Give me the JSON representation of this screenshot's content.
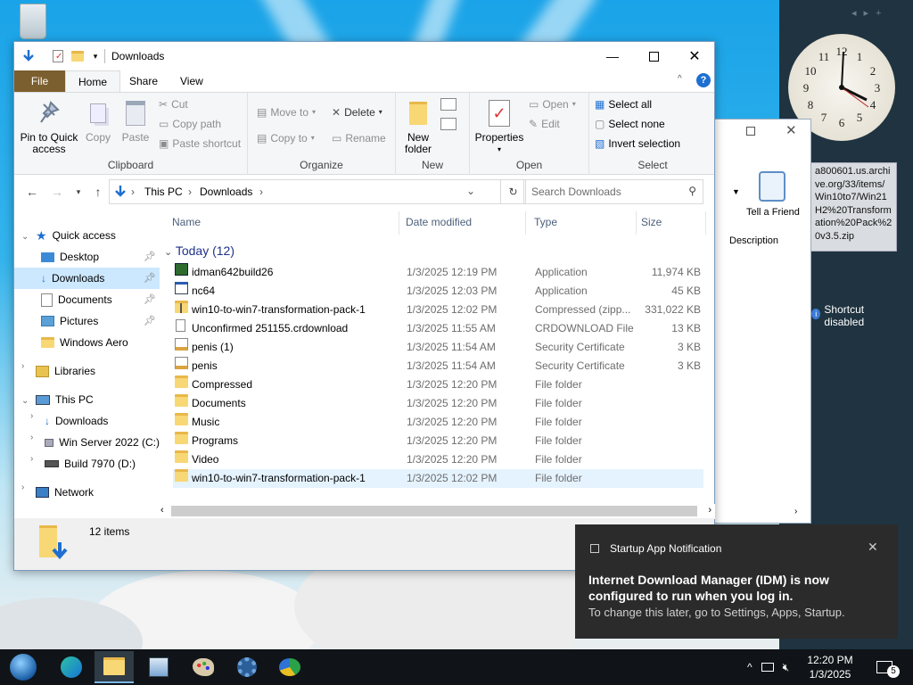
{
  "window": {
    "title": "Downloads"
  },
  "ribbon": {
    "tabs": [
      "File",
      "Home",
      "Share",
      "View"
    ],
    "clipboard": {
      "pin": "Pin to Quick access",
      "copy": "Copy",
      "paste": "Paste",
      "cut": "Cut",
      "copy_path": "Copy path",
      "paste_shortcut": "Paste shortcut",
      "label": "Clipboard"
    },
    "organize": {
      "move_to": "Move to",
      "copy_to": "Copy to",
      "delete": "Delete",
      "rename": "Rename",
      "label": "Organize"
    },
    "new": {
      "new_folder": "New folder",
      "label": "New"
    },
    "open": {
      "properties": "Properties",
      "open": "Open",
      "edit": "Edit",
      "label": "Open"
    },
    "select": {
      "select_all": "Select all",
      "select_none": "Select none",
      "invert": "Invert selection",
      "label": "Select"
    }
  },
  "address": {
    "this_pc": "This PC",
    "downloads": "Downloads",
    "search_placeholder": "Search Downloads"
  },
  "nav": {
    "quick_access": "Quick access",
    "items": [
      "Desktop",
      "Downloads",
      "Documents",
      "Pictures",
      "Windows Aero"
    ],
    "libraries": "Libraries",
    "this_pc": "This PC",
    "pc_items": [
      "Downloads",
      "Win Server 2022 (C:)",
      "Build 7970 (D:)"
    ],
    "network": "Network"
  },
  "columns": {
    "name": "Name",
    "date": "Date modified",
    "type": "Type",
    "size": "Size"
  },
  "group": "Today (12)",
  "files": [
    {
      "name": "idman642build26",
      "date": "1/3/2025 12:19 PM",
      "type": "Application",
      "size": "11,974 KB",
      "icon": "idm-icon"
    },
    {
      "name": "nc64",
      "date": "1/3/2025 12:03 PM",
      "type": "Application",
      "size": "45 KB",
      "icon": "app-icon"
    },
    {
      "name": "win10-to-win7-transformation-pack-1",
      "date": "1/3/2025 12:02 PM",
      "type": "Compressed (zipp...",
      "size": "331,022 KB",
      "icon": "zip-icon"
    },
    {
      "name": "Unconfirmed 251155.crdownload",
      "date": "1/3/2025 11:55 AM",
      "type": "CRDOWNLOAD File",
      "size": "13 KB",
      "icon": "file-icon"
    },
    {
      "name": "penis (1)",
      "date": "1/3/2025 11:54 AM",
      "type": "Security Certificate",
      "size": "3 KB",
      "icon": "cert-icon"
    },
    {
      "name": "penis",
      "date": "1/3/2025 11:54 AM",
      "type": "Security Certificate",
      "size": "3 KB",
      "icon": "cert-icon"
    },
    {
      "name": "Compressed",
      "date": "1/3/2025 12:20 PM",
      "type": "File folder",
      "size": "",
      "icon": "folder-icon"
    },
    {
      "name": "Documents",
      "date": "1/3/2025 12:20 PM",
      "type": "File folder",
      "size": "",
      "icon": "folder-icon"
    },
    {
      "name": "Music",
      "date": "1/3/2025 12:20 PM",
      "type": "File folder",
      "size": "",
      "icon": "folder-icon"
    },
    {
      "name": "Programs",
      "date": "1/3/2025 12:20 PM",
      "type": "File folder",
      "size": "",
      "icon": "folder-icon"
    },
    {
      "name": "Video",
      "date": "1/3/2025 12:20 PM",
      "type": "File folder",
      "size": "",
      "icon": "folder-icon"
    },
    {
      "name": "win10-to-win7-transformation-pack-1",
      "date": "1/3/2025 12:02 PM",
      "type": "File folder",
      "size": "",
      "icon": "folder-icon"
    }
  ],
  "status": {
    "count": "12 items"
  },
  "bgwindow": {
    "tell_friend": "Tell a Friend",
    "description": "Description"
  },
  "sidebar": {
    "download_url": "a800601.us.archive.org/33/items/Win10to7/Win21H2%20Transformation%20Pack%20v3.5.zip",
    "shortcut": "Shortcut disabled"
  },
  "toast": {
    "app": "Startup App Notification",
    "title": "Internet Download Manager (IDM) is now configured to run when you log in.",
    "body": "To change this later, go to Settings, Apps, Startup."
  },
  "tray": {
    "time": "12:20 PM",
    "date": "1/3/2025",
    "notif_count": "5"
  }
}
